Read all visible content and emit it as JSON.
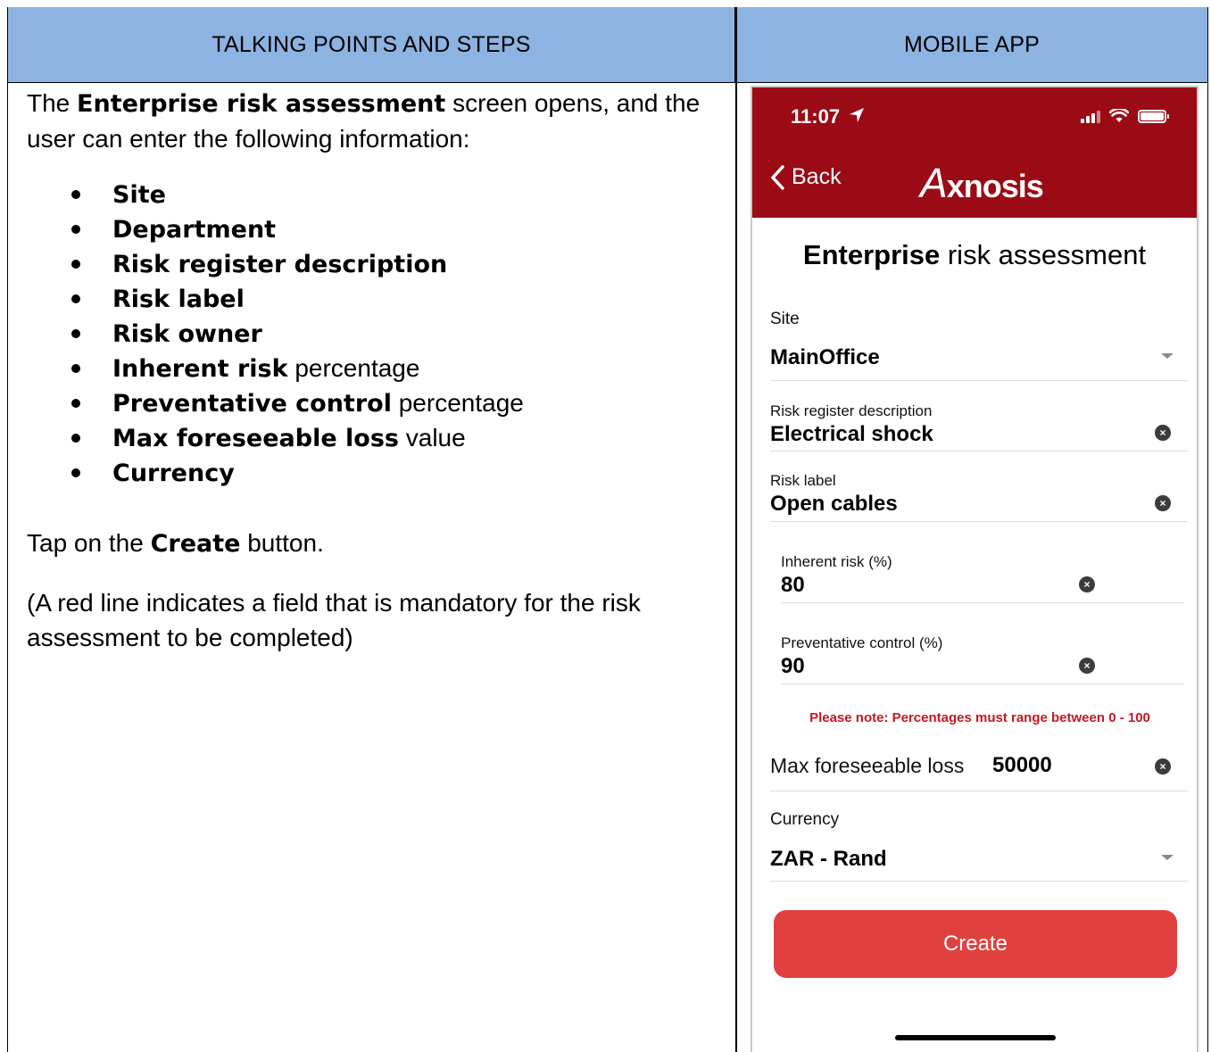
{
  "headers": {
    "left": "TALKING POINTS AND STEPS",
    "right": "MOBILE APP"
  },
  "talking_points": {
    "intro_prefix": "The ",
    "intro_bold": "Enterprise risk assessment",
    "intro_suffix": " screen opens, and the user can enter the following information:",
    "items": [
      {
        "bold": "Site",
        "rest": ""
      },
      {
        "bold": "Department",
        "rest": ""
      },
      {
        "bold": "Risk register description",
        "rest": ""
      },
      {
        "bold": "Risk label",
        "rest": ""
      },
      {
        "bold": "Risk owner",
        "rest": ""
      },
      {
        "bold": "Inherent risk",
        "rest": " percentage"
      },
      {
        "bold": "Preventative control",
        "rest": " percentage"
      },
      {
        "bold": "Max foreseeable loss",
        "rest": " value"
      },
      {
        "bold": "Currency",
        "rest": ""
      }
    ],
    "tap_prefix": "Tap on the ",
    "tap_bold": "Create",
    "tap_suffix": " button.",
    "note": "(A red line indicates a field that is mandatory for the risk assessment to be completed)"
  },
  "app": {
    "status": {
      "time": "11:07",
      "location_icon": "location-arrow-icon"
    },
    "nav": {
      "back_label": "Back",
      "logo": "Axnosis",
      "logo_initial": "A",
      "logo_rest": "xnosis"
    },
    "title_bold": "Enterprise",
    "title_rest": " risk assessment",
    "site": {
      "label": "Site",
      "value": "MainOffice"
    },
    "risk_desc": {
      "label": "Risk register description",
      "value": "Electrical shock"
    },
    "risk_label": {
      "label": "Risk label",
      "value": "Open cables"
    },
    "inherent": {
      "label": "Inherent risk (%)",
      "value": "80"
    },
    "preventative": {
      "label": "Preventative control (%)",
      "value": "90"
    },
    "note": "Please note: Percentages must range between 0 - 100",
    "max_loss": {
      "label": "Max foreseeable loss",
      "value": "50000"
    },
    "currency": {
      "label": "Currency",
      "value": "ZAR - Rand"
    },
    "create_label": "Create",
    "colors": {
      "brand": "#9b0b15",
      "button": "#e0413f",
      "note": "#c4181f",
      "header": "#8db3e2"
    }
  }
}
